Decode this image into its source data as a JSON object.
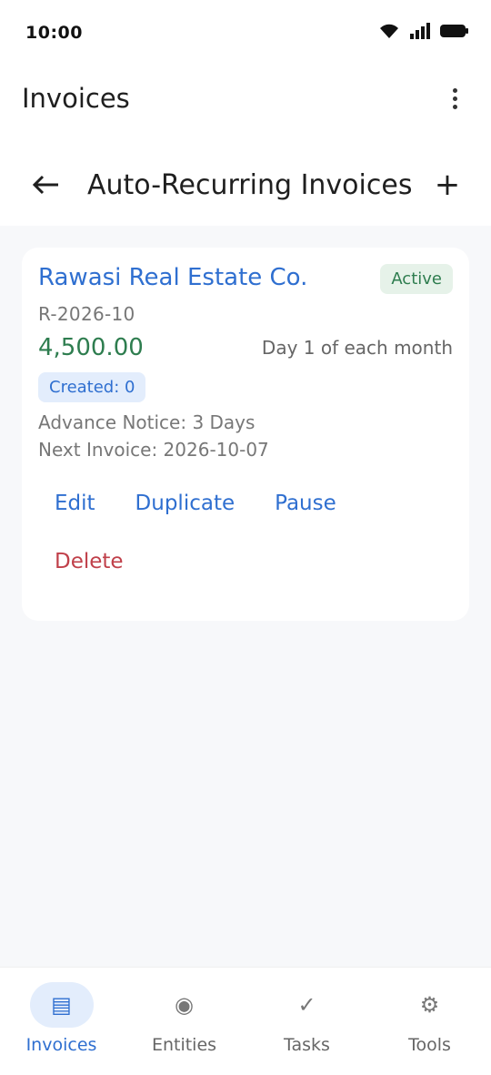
{
  "status_bar": {
    "time": "10:00",
    "icons": [
      "wifi-icon",
      "signal-icon",
      "battery-icon"
    ]
  },
  "app_bar": {
    "title": "Invoices",
    "menu_icon": "more-vert-icon"
  },
  "page_header": {
    "title": "Auto-Recurring Invoices",
    "back_icon": "arrow-left-icon",
    "add_label": "+"
  },
  "card": {
    "customer": "Rawasi Real Estate Co.",
    "status": "Active",
    "invoice_id": "R-2026-10",
    "amount": "4,500.00",
    "schedule": "Day 1 of each month",
    "created": "Created: 0",
    "advance_notice": "Advance Notice: 3 Days",
    "next_invoice": "Next Invoice: 2026-10-07",
    "actions": {
      "edit": "Edit",
      "duplicate": "Duplicate",
      "pause": "Pause",
      "delete": "Delete"
    }
  },
  "bottom_nav": {
    "items": [
      {
        "label": "Invoices",
        "icon": "▤",
        "active": true
      },
      {
        "label": "Entities",
        "icon": "◉",
        "active": false
      },
      {
        "label": "Tasks",
        "icon": "✓",
        "active": false
      },
      {
        "label": "Tools",
        "icon": "⚙",
        "active": false
      }
    ]
  },
  "colors": {
    "accent": "#2f6fd0",
    "success": "#2e7d4f",
    "danger": "#c0404a",
    "background": "#f7f8fa"
  }
}
